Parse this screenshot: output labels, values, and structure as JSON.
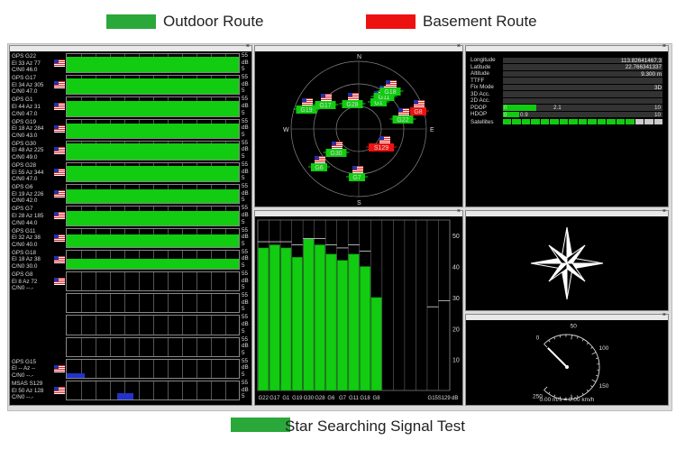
{
  "legend": {
    "outdoor": {
      "label": "Outdoor Route",
      "color": "#2aa83a"
    },
    "basement": {
      "label": "Basement Route",
      "color": "#ee1111"
    },
    "caption": "Star Searching Signal Test"
  },
  "sat_list": {
    "scale_top": "55",
    "scale_mid": "dB",
    "scale_bot": "5",
    "items": [
      {
        "l1": "GPS G22",
        "l2": "El 33 Az 77",
        "l3": "C/N0 46.0",
        "level": 0.78,
        "color": "#11cc11"
      },
      {
        "l1": "GPS G17",
        "l2": "El 34 Az 305",
        "l3": "C/N0 47.0",
        "level": 0.8,
        "color": "#11cc11"
      },
      {
        "l1": "GPS G1",
        "l2": "El 44 Az 31",
        "l3": "C/N0 47.0",
        "level": 0.8,
        "color": "#11cc11"
      },
      {
        "l1": "GPS G19",
        "l2": "El 18 Az 284",
        "l3": "C/N0 43.0",
        "level": 0.74,
        "color": "#11cc11"
      },
      {
        "l1": "GPS G30",
        "l2": "El 48 Az 225",
        "l3": "C/N0 49.0",
        "level": 0.84,
        "color": "#11cc11"
      },
      {
        "l1": "GPS G28",
        "l2": "El 55 Az 344",
        "l3": "C/N0 47.0",
        "level": 0.8,
        "color": "#11cc11"
      },
      {
        "l1": "GPS G6",
        "l2": "El 19 Az 226",
        "l3": "C/N0 42.0",
        "level": 0.72,
        "color": "#11cc11"
      },
      {
        "l1": "GPS G7",
        "l2": "El 28 Az 185",
        "l3": "C/N0 44.0",
        "level": 0.76,
        "color": "#11cc11"
      },
      {
        "l1": "GPS G11",
        "l2": "El 32 Az 38",
        "l3": "C/N0 40.0",
        "level": 0.68,
        "color": "#11cc11"
      },
      {
        "l1": "GPS G18",
        "l2": "El 18 Az 38",
        "l3": "C/N0 30.0",
        "level": 0.5,
        "color": "#11cc11"
      },
      {
        "l1": "GPS G8",
        "l2": "El 8 Az 72",
        "l3": "C/N0 --.-",
        "level": 0.0,
        "color": "#11cc11"
      },
      {
        "l1": "",
        "l2": "",
        "l3": "",
        "level": 0.0,
        "color": "#11cc11"
      },
      {
        "l1": "",
        "l2": "",
        "l3": "",
        "level": 0.0,
        "color": "#11cc11"
      },
      {
        "l1": "",
        "l2": "",
        "l3": "",
        "level": 0.0,
        "color": "#11cc11"
      },
      {
        "l1": "GPS G15",
        "l2": "El -- Az --",
        "l3": "C/N0 --.-",
        "level": 0.25,
        "color": "#2233cc"
      },
      {
        "l1": "MSAS S129",
        "l2": "El 50 Az 128",
        "l3": "C/N0 --.-",
        "level": 0.35,
        "color": "#2233cc"
      }
    ]
  },
  "skyplot": {
    "compass": {
      "n": "N",
      "e": "E",
      "s": "S",
      "w": "W"
    },
    "sats": [
      {
        "id": "G19",
        "color": "#11cc11"
      },
      {
        "id": "G17",
        "color": "#11cc11"
      },
      {
        "id": "G28",
        "color": "#11cc11"
      },
      {
        "id": "G1",
        "color": "#11cc11"
      },
      {
        "id": "G11",
        "color": "#11cc11"
      },
      {
        "id": "G18",
        "color": "#11cc11"
      },
      {
        "id": "G8",
        "color": "#ee1111"
      },
      {
        "id": "G22",
        "color": "#11cc11"
      },
      {
        "id": "S129",
        "color": "#ee1111"
      },
      {
        "id": "G30",
        "color": "#11cc11"
      },
      {
        "id": "G6",
        "color": "#11cc11"
      },
      {
        "id": "G7",
        "color": "#11cc11"
      }
    ]
  },
  "position": {
    "rows": [
      {
        "label": "Longitude",
        "value": "113.82641467.3",
        "fill": 0
      },
      {
        "label": "Latitude",
        "value": "22.766341337",
        "fill": 0
      },
      {
        "label": "Altitude",
        "value": "9.300 m",
        "fill": 0
      },
      {
        "label": "TTFF",
        "value": "",
        "fill": 0
      },
      {
        "label": "Fix Mode",
        "value": "3D",
        "fill": 0
      },
      {
        "label": "3D Acc.",
        "value": "",
        "fill": 0
      },
      {
        "label": "2D Acc.",
        "value": "",
        "fill": 0
      },
      {
        "label": "PDOP",
        "value": "",
        "fill": 0.21
      },
      {
        "label": "HDOP",
        "value": "",
        "fill": 0.1
      }
    ],
    "pdop_min": "0",
    "pdop_val": "2.1",
    "pdop_max": "10",
    "hdop_min": "0",
    "hdop_val": "0.9",
    "hdop_max": "10",
    "satellites_label": "Satellites",
    "satellites_bars": [
      "#11cc11",
      "#11cc11",
      "#11cc11",
      "#11cc11",
      "#11cc11",
      "#11cc11",
      "#11cc11",
      "#11cc11",
      "#11cc11",
      "#11cc11",
      "#11cc11",
      "#11cc11",
      "#11cc11",
      "#11cc11",
      "#cccccc",
      "#cccccc",
      "#cccccc"
    ]
  },
  "snr_chart": {
    "labels": [
      "G22",
      "G17",
      "G1",
      "G19",
      "G30",
      "G28",
      "G6",
      "G7",
      "G11",
      "G18",
      "G8",
      "",
      "",
      "",
      "",
      "G15",
      "S129"
    ],
    "values": [
      46,
      47,
      46,
      43,
      49,
      47,
      44,
      42,
      44,
      40,
      30,
      0,
      0,
      0,
      0,
      0,
      0
    ],
    "ref": [
      48,
      48,
      48,
      47,
      49,
      49,
      47,
      46,
      47,
      45,
      0,
      0,
      0,
      0,
      0,
      27,
      29
    ],
    "yticks": [
      "50",
      "40",
      "30",
      "20",
      "10"
    ],
    "unit": "dB",
    "ymax": 55,
    "color": "#11cc11"
  },
  "speedometer": {
    "ticks": [
      "0",
      "50",
      "100",
      "150",
      "200",
      "250"
    ],
    "readout": "0.00 m/s = 0.00 km/h",
    "value": 0
  }
}
